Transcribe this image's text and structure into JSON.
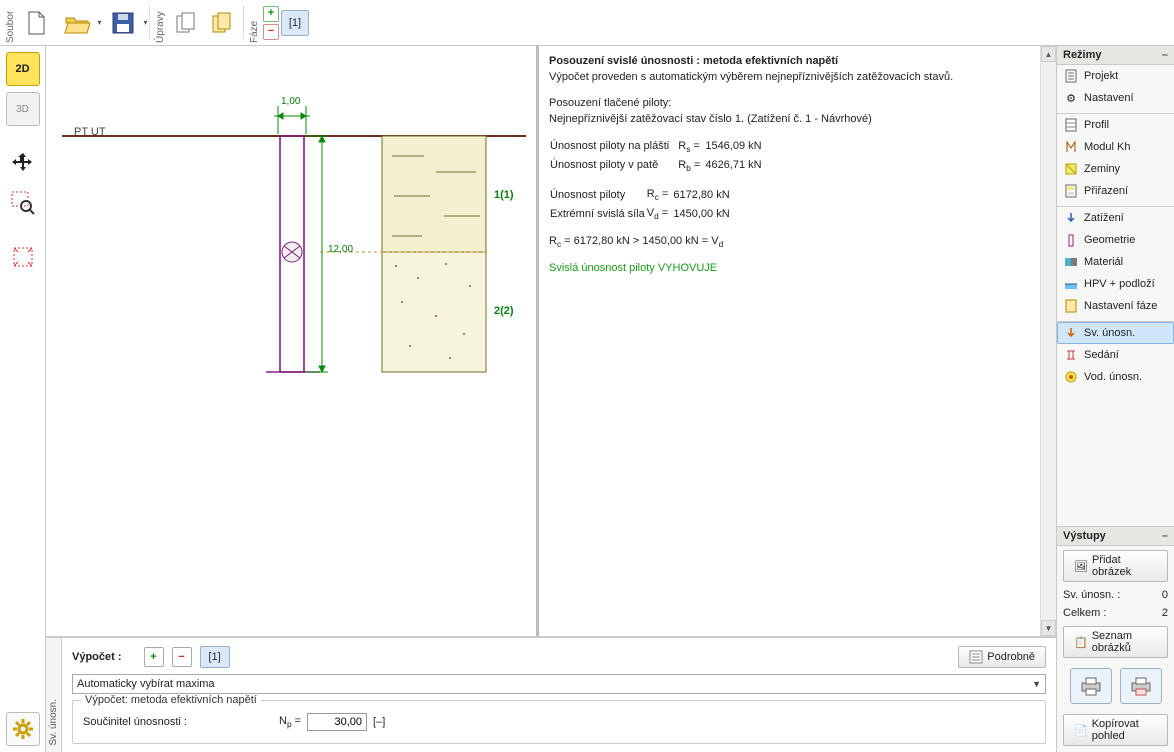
{
  "toolbar": {
    "group_file": "Soubor",
    "group_edit": "Úpravy",
    "group_phase": "Fáze",
    "stage_badge": "[1]"
  },
  "leftrail": {
    "v2d": "2D",
    "v3d": "3D"
  },
  "view2d": {
    "ground_label": "PT UT",
    "width_dim": "1,00",
    "depth_dim": "12,00",
    "layer1": "1(1)",
    "layer2": "2(2)"
  },
  "results": {
    "title": "Posouzení svislé únosnosti : metoda efektivních napětí",
    "subtitle": "Výpočet proveden s automatickým výběrem nejnepříznivějších zatěžovacích stavů.",
    "sect1_h": "Posouzení tlačené piloty:",
    "sect1_l1": "Nejnepříznivější zatěžovací stav číslo 1. (Zatížení č. 1 - Návrhové)",
    "l_rs": "Únosnost piloty na plášti",
    "l_rb": "Únosnost piloty v patě",
    "l_rc": "Únosnost piloty",
    "l_vd": "Extrémní svislá síla",
    "eq_final_lhs": "R",
    "eq_final": " = 6172,80 kN > 1450,00 kN = V",
    "verdict": "Svislá únosnost piloty VYHOVUJE",
    "rs_val": "1546,09 kN",
    "rb_val": "4626,71 kN",
    "rc_val": "6172,80 kN",
    "vd_val": "1450,00 kN"
  },
  "bottom_tab": "Sv. únosn.",
  "calc": {
    "label": "Výpočet :",
    "detail_btn": "Podrobně",
    "stage_btn": "[1]",
    "dropdown": "Automaticky vybírat maxima",
    "legend": "Výpočet: metoda efektivních napětí",
    "coef_label": "Součinitel únosnosti :",
    "np_sym": "N",
    "np_sub": "p",
    "np_eq": " = ",
    "np_val": "30,00",
    "np_unit": "[–]"
  },
  "right": {
    "modes_hdr": "Režimy",
    "items": [
      {
        "label": "Projekt",
        "icon": "doc"
      },
      {
        "label": "Nastavení",
        "icon": "gear"
      },
      {
        "label": "Profil",
        "icon": "profile"
      },
      {
        "label": "Modul Kh",
        "icon": "modkh"
      },
      {
        "label": "Zeminy",
        "icon": "soil"
      },
      {
        "label": "Přiřazení",
        "icon": "assign"
      },
      {
        "label": "Zatížení",
        "icon": "load"
      },
      {
        "label": "Geometrie",
        "icon": "geom"
      },
      {
        "label": "Materiál",
        "icon": "mat"
      },
      {
        "label": "HPV + podloží",
        "icon": "water"
      },
      {
        "label": "Nastavení fáze",
        "icon": "phase"
      },
      {
        "label": "Sv. únosn.",
        "icon": "svu",
        "sel": true
      },
      {
        "label": "Sedání",
        "icon": "sett"
      },
      {
        "label": "Vod. únosn.",
        "icon": "vod"
      }
    ],
    "out_hdr": "Výstupy",
    "add_img": "Přidat obrázek",
    "svu_lbl": "Sv. únosn. :",
    "svu_n": "0",
    "tot_lbl": "Celkem :",
    "tot_n": "2",
    "list_img": "Seznam obrázků",
    "copy_view": "Kopírovat pohled"
  }
}
